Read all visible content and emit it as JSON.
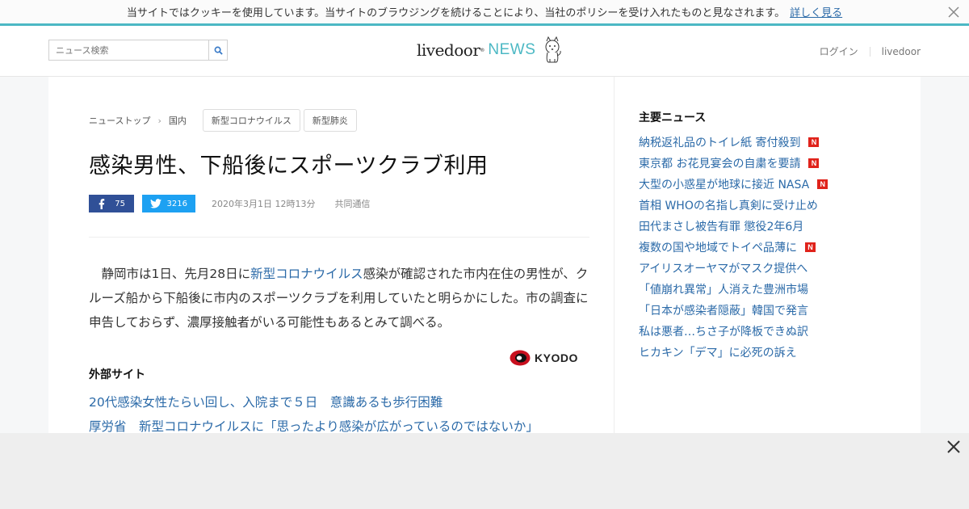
{
  "cookie": {
    "text": "当サイトではクッキーを使用しています。当サイトのブラウジングを続けることにより、当社のポリシーを受け入れたものと見なされます。",
    "link": "詳しく見る"
  },
  "header": {
    "search_placeholder": "ニュース検索",
    "logo_main": "livedoor",
    "logo_reg": "®",
    "logo_news": "NEWS",
    "login": "ログイン",
    "livedoor": "livedoor"
  },
  "breadcrumb": {
    "items": [
      "ニューストップ",
      "国内"
    ],
    "tags": [
      "新型コロナウイルス",
      "新型肺炎"
    ]
  },
  "article": {
    "title": "感染男性、下船後にスポーツクラブ利用",
    "fb_count": "75",
    "tw_count": "3216",
    "date": "2020年3月1日 12時13分",
    "source": "共同通信",
    "body_pre": "静岡市は1日、先月28日に",
    "body_link": "新型コロナウイルス",
    "body_post": "感染が確認された市内在住の男性が、クルーズ船から下船後に市内のスポーツクラブを利用していたと明らかにした。市の調査に申告しておらず、濃厚接触者がいる可能性もあるとみて調べる。",
    "provider_logo": "KYODO"
  },
  "external": {
    "title": "外部サイト",
    "links": [
      "20代感染女性たらい回し、入院まで５日　意識あるも歩行困難",
      "厚労省　新型コロナウイルスに「思ったより感染が広がっているのではないか」"
    ]
  },
  "sidebar": {
    "title": "主要ニュース",
    "items": [
      {
        "text": "納税返礼品のトイレ紙 寄付殺到",
        "new": true
      },
      {
        "text": "東京都 お花見宴会の自粛を要請",
        "new": true
      },
      {
        "text": "大型の小惑星が地球に接近 NASA",
        "new": true
      },
      {
        "text": "首相 WHOの名指し真剣に受け止め",
        "new": false
      },
      {
        "text": "田代まさし被告有罪 懲役2年6月",
        "new": false
      },
      {
        "text": "複数の国や地域でトイペ品薄に",
        "new": true
      },
      {
        "text": "アイリスオーヤマがマスク提供へ",
        "new": false
      },
      {
        "text": "「値崩れ異常」人消えた豊洲市場",
        "new": false
      },
      {
        "text": "「日本が感染者隠蔽」韓国で発言",
        "new": false
      },
      {
        "text": "私は悪者…ちさ子が降板できぬ訳",
        "new": false
      },
      {
        "text": "ヒカキン「デマ」に必死の訴え",
        "new": false
      }
    ],
    "badge_label": "N"
  },
  "colors": {
    "accent": "#4cb8c4",
    "link": "#2b6aa8",
    "facebook": "#305097",
    "twitter": "#1da1f2",
    "new_badge": "#e0231b"
  },
  "icons": {
    "search": "search-icon",
    "close": "close-icon",
    "facebook": "facebook-icon",
    "twitter": "twitter-icon",
    "mascot": "dog-mascot-icon"
  }
}
